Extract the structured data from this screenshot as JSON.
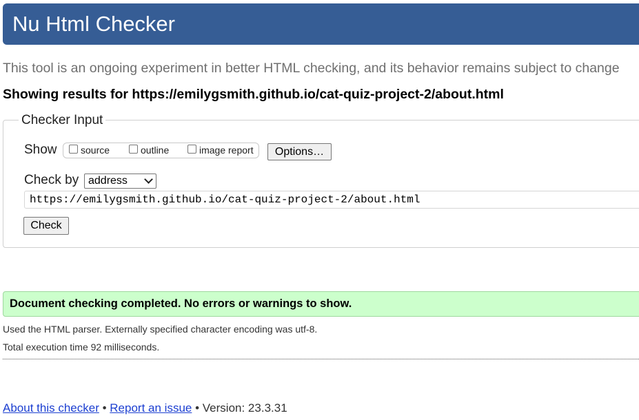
{
  "header": {
    "title": "Nu Html Checker"
  },
  "intro": {
    "text": "This tool is an ongoing experiment in better HTML checking, and its behavior remains subject to change"
  },
  "results": {
    "showing_text": "Showing results for https://emilygsmith.github.io/cat-quiz-project-2/about.html"
  },
  "checker_input": {
    "legend": "Checker Input",
    "show_label": "Show",
    "options": [
      {
        "label": "source",
        "checked": false
      },
      {
        "label": "outline",
        "checked": false
      },
      {
        "label": "image report",
        "checked": false
      }
    ],
    "options_button": "Options…",
    "check_by_label": "Check by",
    "check_by_value": "address",
    "url_value": "https://emilygsmith.github.io/cat-quiz-project-2/about.html",
    "check_button": "Check"
  },
  "status": {
    "message": "Document checking completed. No errors or warnings to show.",
    "parser_info": "Used the HTML parser. Externally specified character encoding was utf-8.",
    "execution_time": "Total execution time 92 milliseconds."
  },
  "footer": {
    "about_link": "About this checker",
    "separator": "•",
    "report_link": "Report an issue",
    "version": "Version: 23.3.31"
  },
  "colors": {
    "header_bg": "#365d95",
    "success_bg": "#ccffcc",
    "link": "#1c3fd1"
  }
}
